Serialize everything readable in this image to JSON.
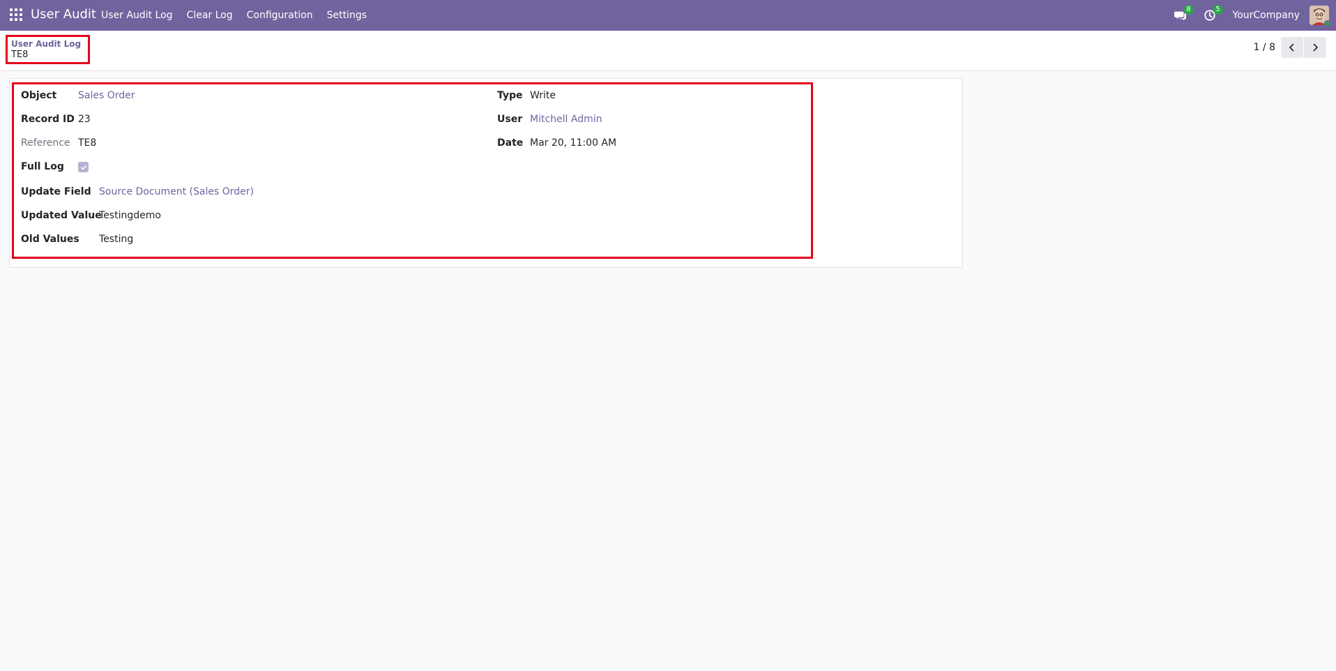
{
  "navbar": {
    "app_name": "User Audit",
    "menu": [
      {
        "label": "User Audit Log"
      },
      {
        "label": "Clear Log"
      },
      {
        "label": "Configuration"
      },
      {
        "label": "Settings"
      }
    ],
    "messages_badge": "8",
    "activities_badge": "5",
    "company": "YourCompany",
    "color": "#71639e"
  },
  "breadcrumb": {
    "parent": "User Audit Log",
    "current": "TE8"
  },
  "pager": {
    "value": "1 / 8"
  },
  "form": {
    "object": {
      "label": "Object",
      "value": "Sales Order"
    },
    "record_id": {
      "label": "Record ID",
      "value": "23"
    },
    "reference": {
      "label": "Reference",
      "value": "TE8"
    },
    "full_log": {
      "label": "Full Log",
      "checked": true
    },
    "type": {
      "label": "Type",
      "value": "Write"
    },
    "user": {
      "label": "User",
      "value": "Mitchell Admin"
    },
    "date": {
      "label": "Date",
      "value": "Mar 20, 11:00 AM"
    },
    "update_field": {
      "label": "Update Field",
      "value": "Source Document (Sales Order)"
    },
    "updated_value": {
      "label": "Updated Value",
      "value": "Testingdemo"
    },
    "old_values": {
      "label": "Old Values",
      "value": "Testing"
    }
  },
  "colors": {
    "accent": "#71639e",
    "highlight": "#e3001b",
    "badge": "#28a745"
  }
}
